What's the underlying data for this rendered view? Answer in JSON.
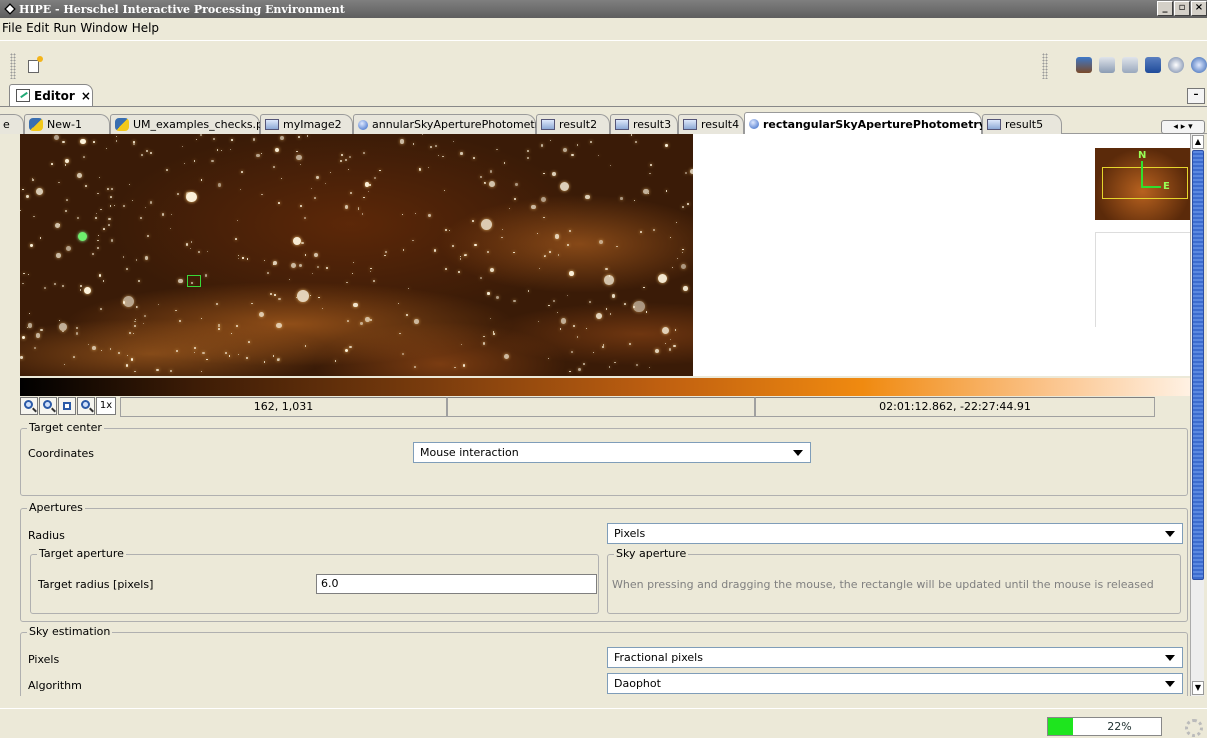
{
  "window": {
    "title": "HIPE - Herschel Interactive Processing Environment",
    "controls": [
      "_",
      "▫",
      "×"
    ]
  },
  "menu": [
    "File",
    "Edit",
    "Run",
    "Window",
    "Help"
  ],
  "view_tab": {
    "label": "Editor",
    "close": "×",
    "minmax": "–"
  },
  "tabs": [
    {
      "label": "e",
      "icon": "none",
      "left": 0,
      "width": 26
    },
    {
      "label": "New-1",
      "icon": "python-icon"
    },
    {
      "label": "UM_examples_checks.py",
      "icon": "python-icon"
    },
    {
      "label": "myImage2",
      "icon": "image-icon"
    },
    {
      "label": "annularSkyAperturePhotometry",
      "icon": "task-icon"
    },
    {
      "label": "result2",
      "icon": "image-icon"
    },
    {
      "label": "result3",
      "icon": "image-icon"
    },
    {
      "label": "result4",
      "icon": "image-icon"
    },
    {
      "label": "rectangularSkyAperturePhotometry",
      "icon": "task-icon",
      "active": true,
      "close": "×"
    },
    {
      "label": "result5",
      "icon": "image-icon"
    }
  ],
  "tab_nav": "◂ ▸ ▾",
  "image_viewer": {
    "zoom_label": "1x",
    "pixel_coords": "162, 1,031",
    "value": "",
    "sky_coords": "02:01:12.862, -22:27:44.91",
    "overview_north": "N",
    "overview_east": "E"
  },
  "target_center": {
    "legend": "Target center",
    "coordinates_label": "Coordinates",
    "coordinates_value": "Mouse interaction"
  },
  "apertures": {
    "legend": "Apertures",
    "radius_label": "Radius",
    "radius_value": "Pixels",
    "target_aperture": {
      "legend": "Target aperture",
      "radius_label": "Target radius [pixels]",
      "radius_value": "6.0"
    },
    "sky_aperture": {
      "legend": "Sky aperture",
      "hint": "When pressing and dragging the mouse, the rectangle will be updated until the mouse is released"
    }
  },
  "sky_estimation": {
    "legend": "Sky estimation",
    "pixels_label": "Pixels",
    "pixels_value": "Fractional pixels",
    "algorithm_label": "Algorithm",
    "algorithm_value": "Daophot"
  },
  "status": {
    "progress_text": "22%",
    "progress_fraction": 0.22
  },
  "colors": {
    "progress_fill": "#1ee51e",
    "accent": "#3c6ccf",
    "marker": "#6ef06e"
  }
}
